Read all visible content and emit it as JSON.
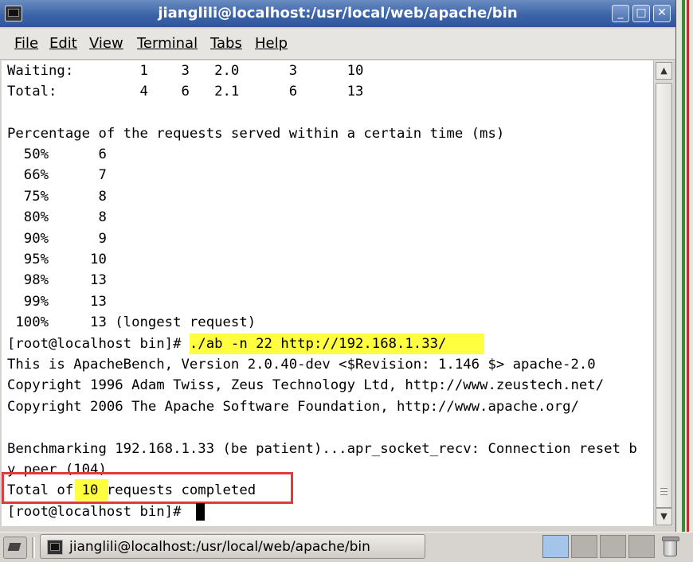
{
  "window": {
    "title": "jianglili@localhost:/usr/local/web/apache/bin",
    "buttons": {
      "minimize": "_",
      "maximize": "□",
      "close": "✕"
    }
  },
  "menu": [
    {
      "label": "File"
    },
    {
      "label": "Edit"
    },
    {
      "label": "View"
    },
    {
      "label": "Terminal"
    },
    {
      "label": "Tabs"
    },
    {
      "label": "Help"
    }
  ],
  "terminal": {
    "lines": [
      "Waiting:        1    3   2.0      3      10",
      "Total:          4    6   2.1      6      13",
      "",
      "Percentage of the requests served within a certain time (ms)",
      "  50%      6",
      "  66%      7",
      "  75%      8",
      "  80%      8",
      "  90%      9",
      "  95%     10",
      "  98%     13",
      "  99%     13",
      " 100%     13 (longest request)",
      "[root@localhost bin]# ./ab -n 22 http://192.168.1.33/",
      "This is ApacheBench, Version 2.0.40-dev <$Revision: 1.146 $> apache-2.0",
      "Copyright 1996 Adam Twiss, Zeus Technology Ltd, http://www.zeustech.net/",
      "Copyright 2006 The Apache Software Foundation, http://www.apache.org/",
      "",
      "Benchmarking 192.168.1.33 (be patient)...apr_socket_recv: Connection reset b",
      "y peer (104)",
      "Total of 10 requests completed",
      "[root@localhost bin]# "
    ]
  },
  "taskbar": {
    "task_label": "jianglili@localhost:/usr/local/web/apache/bin"
  }
}
